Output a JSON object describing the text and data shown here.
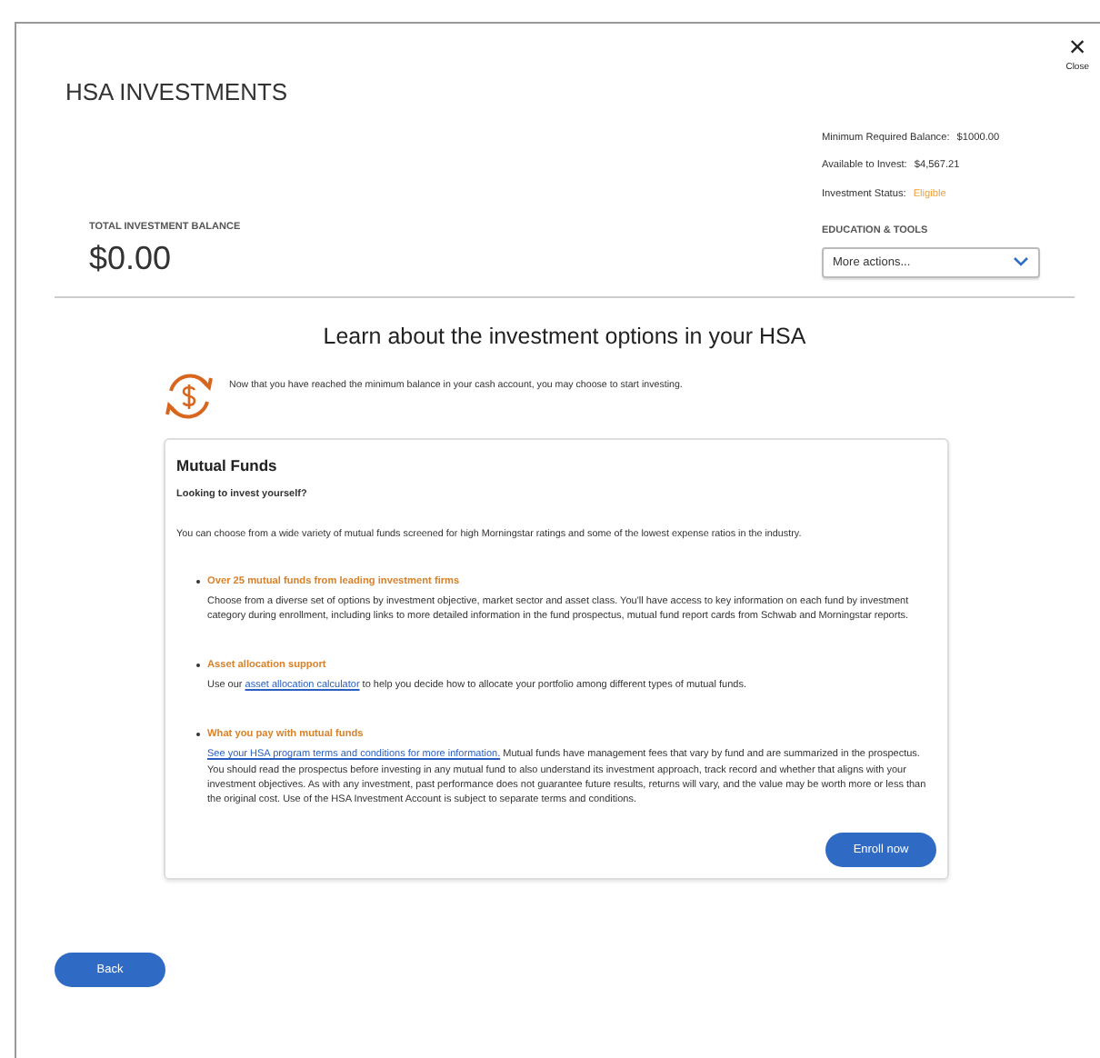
{
  "close": {
    "icon": "×",
    "label": "Close"
  },
  "title": "HSA INVESTMENTS",
  "summary": [
    {
      "label": "Minimum Required Balance:",
      "value": "$1000.00",
      "kind": "plain"
    },
    {
      "label": "Available to Invest:",
      "value": "$4,567.21",
      "kind": "plain"
    },
    {
      "label": "Investment Status:",
      "value": "Eligible",
      "kind": "status"
    }
  ],
  "balance": {
    "label": "TOTAL INVESTMENT BALANCE",
    "value": "$0.00"
  },
  "tools": {
    "label": "EDUCATION & TOOLS",
    "dropdown": "More actions..."
  },
  "heading": "Learn about the investment options in your HSA",
  "intro": "Now that you have reached the minimum balance in your cash account, you may choose to start investing.",
  "card": {
    "title": "Mutual Funds",
    "subtitle": "Looking to invest yourself?",
    "lead": "You can choose from a wide variety of mutual funds screened for high Morningstar ratings and some of the lowest expense ratios in the industry.",
    "items": [
      {
        "title": "Over 25 mutual funds from leading investment firms",
        "body": [
          {
            "kind": "text",
            "text": "Choose from a diverse set of options by investment objective, market sector and asset class. You'll have access to key information on each fund by investment category during enrollment, including links to more detailed information in the fund prospectus, mutual fund report cards from Schwab and Morningstar reports."
          }
        ]
      },
      {
        "title": "Asset allocation support",
        "body": [
          {
            "kind": "text",
            "text": "Use our "
          },
          {
            "kind": "link",
            "text": "asset allocation calculator"
          },
          {
            "kind": "text",
            "text": " to help you decide how to allocate your portfolio among different types of mutual funds."
          }
        ]
      },
      {
        "title": "What you pay with mutual funds",
        "body": [
          {
            "kind": "link",
            "text": "See your HSA program terms and conditions for more information."
          },
          {
            "kind": "text",
            "text": " Mutual funds have management fees that vary by fund and are summarized in the prospectus. You should read the prospectus before investing in any mutual fund to also understand its investment approach, track record and whether that aligns with your investment objectives. As with any investment, past performance does not guarantee future results, returns will vary, and the value may be worth more or less than the original cost. Use of the HSA Investment Account is subject to separate terms and conditions."
          }
        ]
      }
    ],
    "button": "Enroll now"
  },
  "back": "Back"
}
